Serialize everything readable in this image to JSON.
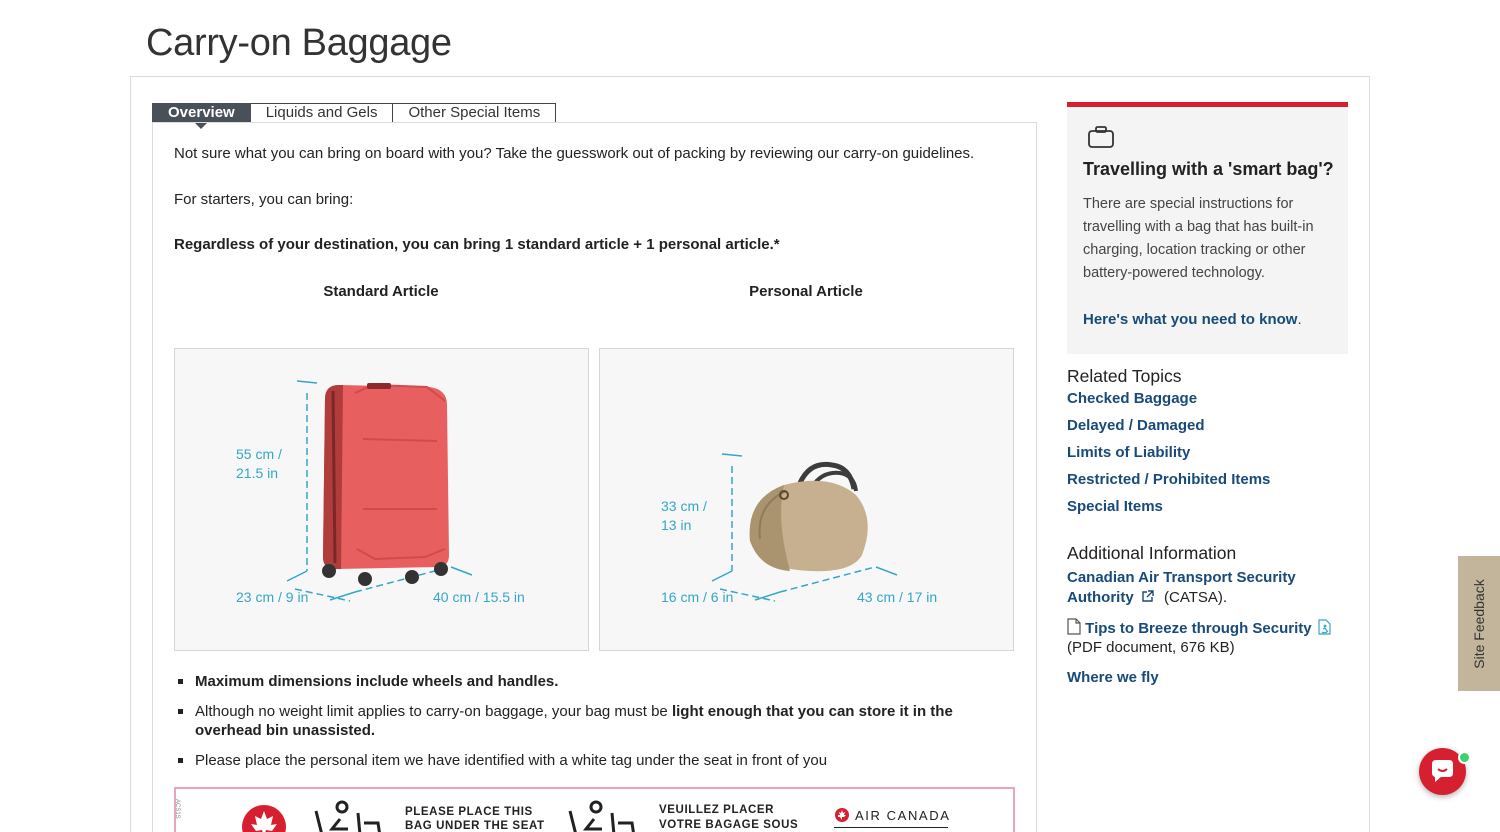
{
  "page": {
    "title": "Carry-on Baggage"
  },
  "tabs": [
    {
      "label": "Overview",
      "active": true
    },
    {
      "label": "Liquids and Gels",
      "active": false
    },
    {
      "label": "Other Special Items",
      "active": false
    }
  ],
  "main": {
    "intro": "Not sure what you can bring on board with you? Take the guesswork out of packing by reviewing our carry-on guidelines.",
    "starters": "For starters, you can bring:",
    "regardless": "Regardless of your destination, you can bring 1 standard article + 1 personal article.*",
    "standard": {
      "heading": "Standard Article",
      "height_label": "55 cm /\n21.5 in",
      "depth_label": "23 cm / 9 in",
      "width_label": "40 cm / 15.5 in"
    },
    "personal": {
      "heading": "Personal Article",
      "height_label": "33 cm /\n13 in",
      "depth_label": "16 cm / 6 in",
      "width_label": "43 cm / 17 in"
    },
    "bullets": {
      "b1": "Maximum dimensions include wheels and handles.",
      "b2_pre": "Although no weight limit applies to carry-on baggage, your bag must be ",
      "b2_bold": "light enough that you can store it in the overhead bin unassisted.",
      "b3": "Please place the personal item we have identified with a white tag under the seat in front of you"
    },
    "tag": {
      "en_line1": "PLEASE PLACE THIS",
      "en_line2": "BAG UNDER THE SEAT",
      "fr_line1": "VEUILLEZ PLACER",
      "fr_line2": "VOTRE BAGAGE SOUS",
      "brand": "AIR CANADA",
      "code": "ACS1S"
    }
  },
  "sidebar": {
    "smart_bag": {
      "icon": "briefcase-icon",
      "title": "Travelling with a 'smart bag'?",
      "body": "There are special instructions for travelling with a bag that has built-in charging, location tracking or other battery-powered technology.",
      "link": "Here's what you need to know",
      "link_suffix": "."
    },
    "related": {
      "heading": "Related Topics",
      "links": [
        "Checked Baggage",
        "Delayed / Damaged",
        "Limits of Liability",
        "Restricted / Prohibited Items",
        "Special Items"
      ]
    },
    "additional": {
      "heading": "Additional Information",
      "catsa_line1": "Canadian Air Transport Security",
      "catsa_line2": "Authority",
      "catsa_abbr": "(CATSA).",
      "tips_link": "Tips to Breeze through Security",
      "tips_meta": "(PDF document, 676 KB)",
      "where_we_fly": "Where we fly"
    }
  },
  "feedback": {
    "label": "Site Feedback"
  },
  "colors": {
    "brand_red": "#d6202f",
    "link_blue": "#184a7a",
    "dimension_cyan": "#35a6c8",
    "feedback_tan": "#c2b59b"
  }
}
